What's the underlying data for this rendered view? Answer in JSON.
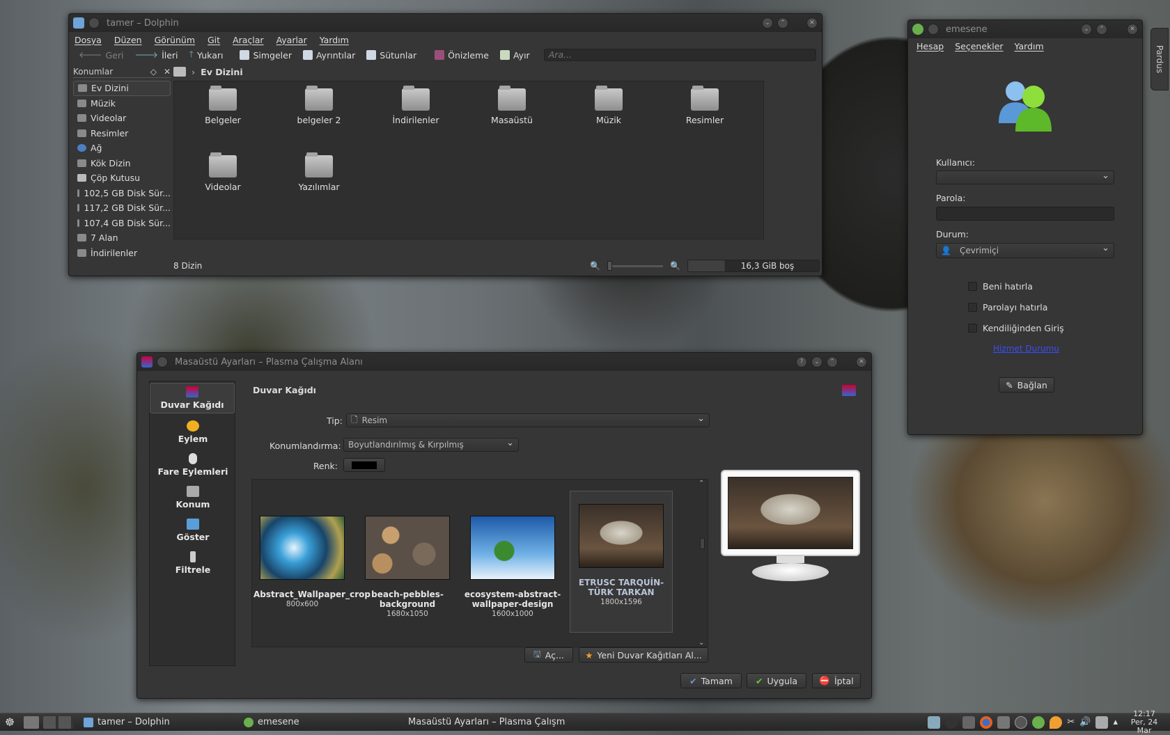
{
  "dolphin": {
    "title": "tamer – Dolphin",
    "menu": [
      "Dosya",
      "Düzen",
      "Görünüm",
      "Git",
      "Araçlar",
      "Ayarlar",
      "Yardım"
    ],
    "toolbar": {
      "back": "Geri",
      "forward": "İleri",
      "up": "Yukarı",
      "icons": "Simgeler",
      "details": "Ayrıntılar",
      "columns": "Sütunlar",
      "preview": "Önizleme",
      "split": "Ayır",
      "search_placeholder": "Ara..."
    },
    "places_title": "Konumlar",
    "places": [
      "Ev Dizini",
      "Müzik",
      "Videolar",
      "Resimler",
      "Ağ",
      "Kök Dizin",
      "Çöp Kutusu",
      "102,5 GB Disk Sür...",
      "117,2 GB Disk Sür...",
      "107,4 GB Disk Sür...",
      "7 Alan",
      "İndirilenler"
    ],
    "breadcrumb": "Ev Dizini",
    "items": [
      "Belgeler",
      "belgeler 2",
      "İndirilenler",
      "Masaüstü",
      "Müzik",
      "Resimler",
      "Videolar",
      "Yazılımlar"
    ],
    "status": "8 Dizin",
    "free": "16,3 GiB boş"
  },
  "emesene": {
    "title": "emesene",
    "menu": [
      "Hesap",
      "Seçenekler",
      "Yardım"
    ],
    "user_label": "Kullanıcı:",
    "pass_label": "Parola:",
    "status_label": "Durum:",
    "status_value": "Çevrimiçi",
    "remember": "Beni hatırla",
    "remember_pass": "Parolayı hatırla",
    "auto_login": "Kendiliğinden Giriş",
    "service_link": "Hizmet Durumu",
    "connect": "Bağlan",
    "side_tab": "Pardus"
  },
  "desktop": {
    "title": "Masaüstü Ayarları – Plasma Çalışma Alanı",
    "categories": [
      "Duvar Kağıdı",
      "Eylem",
      "Fare Eylemleri",
      "Konum",
      "Göster",
      "Filtrele"
    ],
    "heading": "Duvar Kağıdı",
    "type_label": "Tip:",
    "type_value": "Resim",
    "position_label": "Konumlandırma:",
    "position_value": "Boyutlandırılmış & Kırpılmış",
    "color_label": "Renk:",
    "wallpapers": [
      {
        "name": "Abstract_Wallpaper_crop",
        "size": "800x600"
      },
      {
        "name": "beach-pebbles-background",
        "size": "1680x1050"
      },
      {
        "name": "ecosystem-abstract-wallpaper-design",
        "size": "1600x1000"
      },
      {
        "name": "ETRUSC TARQUİN-TÜRK TARKAN",
        "size": "1800x1596"
      }
    ],
    "open": "Aç...",
    "get_new": "Yeni Duvar Kağıtları Al...",
    "ok": "Tamam",
    "apply": "Uygula",
    "cancel": "İptal"
  },
  "taskbar": {
    "tasks": [
      "tamer – Dolphin",
      "emesene",
      "Masaüstü Ayarları – Plasma Çalışm"
    ],
    "time": "12:17",
    "date": "Per, 24 Mar"
  }
}
